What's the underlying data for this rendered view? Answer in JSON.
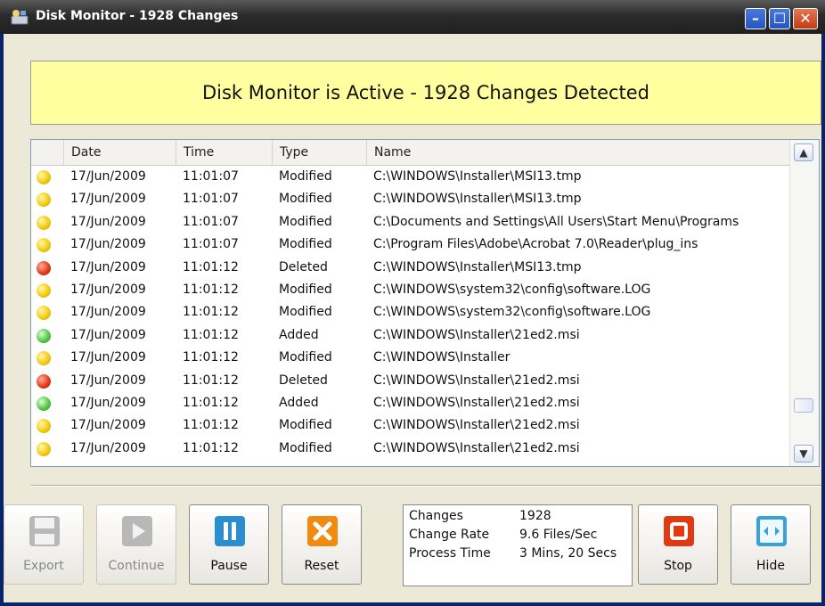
{
  "window": {
    "title": "Disk Monitor - 1928 Changes",
    "controls": [
      "minimize",
      "maximize",
      "close"
    ]
  },
  "banner": {
    "text": "Disk Monitor is Active - 1928 Changes Detected"
  },
  "list": {
    "columns": [
      "Date",
      "Time",
      "Type",
      "Name"
    ],
    "rows": [
      {
        "status": "yellow",
        "date": "17/Jun/2009",
        "time": "11:01:07",
        "type": "Modified",
        "name": "C:\\WINDOWS\\Installer\\MSI13.tmp"
      },
      {
        "status": "yellow",
        "date": "17/Jun/2009",
        "time": "11:01:07",
        "type": "Modified",
        "name": "C:\\WINDOWS\\Installer\\MSI13.tmp"
      },
      {
        "status": "yellow",
        "date": "17/Jun/2009",
        "time": "11:01:07",
        "type": "Modified",
        "name": "C:\\Documents and Settings\\All Users\\Start Menu\\Programs"
      },
      {
        "status": "yellow",
        "date": "17/Jun/2009",
        "time": "11:01:07",
        "type": "Modified",
        "name": "C:\\Program Files\\Adobe\\Acrobat 7.0\\Reader\\plug_ins"
      },
      {
        "status": "red",
        "date": "17/Jun/2009",
        "time": "11:01:12",
        "type": "Deleted",
        "name": "C:\\WINDOWS\\Installer\\MSI13.tmp"
      },
      {
        "status": "yellow",
        "date": "17/Jun/2009",
        "time": "11:01:12",
        "type": "Modified",
        "name": "C:\\WINDOWS\\system32\\config\\software.LOG"
      },
      {
        "status": "yellow",
        "date": "17/Jun/2009",
        "time": "11:01:12",
        "type": "Modified",
        "name": "C:\\WINDOWS\\system32\\config\\software.LOG"
      },
      {
        "status": "green",
        "date": "17/Jun/2009",
        "time": "11:01:12",
        "type": "Added",
        "name": "C:\\WINDOWS\\Installer\\21ed2.msi"
      },
      {
        "status": "yellow",
        "date": "17/Jun/2009",
        "time": "11:01:12",
        "type": "Modified",
        "name": "C:\\WINDOWS\\Installer"
      },
      {
        "status": "red",
        "date": "17/Jun/2009",
        "time": "11:01:12",
        "type": "Deleted",
        "name": "C:\\WINDOWS\\Installer\\21ed2.msi"
      },
      {
        "status": "green",
        "date": "17/Jun/2009",
        "time": "11:01:12",
        "type": "Added",
        "name": "C:\\WINDOWS\\Installer\\21ed2.msi"
      },
      {
        "status": "yellow",
        "date": "17/Jun/2009",
        "time": "11:01:12",
        "type": "Modified",
        "name": "C:\\WINDOWS\\Installer\\21ed2.msi"
      },
      {
        "status": "yellow",
        "date": "17/Jun/2009",
        "time": "11:01:12",
        "type": "Modified",
        "name": "C:\\WINDOWS\\Installer\\21ed2.msi"
      }
    ]
  },
  "buttons": {
    "export": "Export",
    "continue": "Continue",
    "pause": "Pause",
    "reset": "Reset",
    "stop": "Stop",
    "hide": "Hide"
  },
  "stats": {
    "changes_label": "Changes",
    "changes_value": "1928",
    "rate_label": "Change Rate",
    "rate_value": "9.6 Files/Sec",
    "time_label": "Process Time",
    "time_value": "3 Mins, 20 Secs"
  },
  "colors": {
    "banner_bg": "#ffff9f",
    "modified": "#f4cc10",
    "deleted": "#e83a1a",
    "added": "#58c84a",
    "pause_icon": "#2a8fd0",
    "reset_icon": "#f08a10",
    "stop_icon": "#e03a12",
    "hide_icon": "#3aa0d8"
  }
}
